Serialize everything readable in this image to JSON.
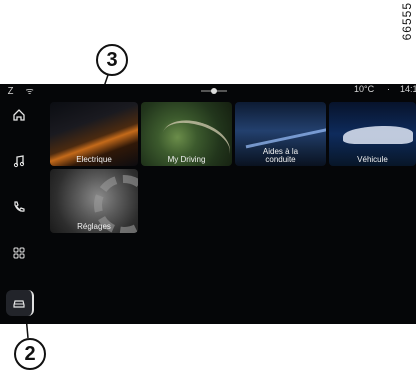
{
  "reference_code": "66555",
  "callouts": {
    "top": "3",
    "bottom": "2"
  },
  "status_bar": {
    "left_icons": "Ｚ ᯤ",
    "temperature": "10°C",
    "separator": "·",
    "time": "14:1"
  },
  "sidebar": {
    "items": [
      {
        "icon": "home-icon"
      },
      {
        "icon": "music-icon"
      },
      {
        "icon": "phone-icon"
      },
      {
        "icon": "apps-grid-icon"
      },
      {
        "icon": "car-icon",
        "active": true
      }
    ]
  },
  "tiles": {
    "electrique": "Electrique",
    "my_driving": "My Driving",
    "aides_line1": "Aides à la",
    "aides_line2": "conduite",
    "vehicule": "Véhicule",
    "reglages": "Réglages"
  },
  "colors": {
    "screen_bg": "#050608",
    "accent": "#c46a1a"
  }
}
